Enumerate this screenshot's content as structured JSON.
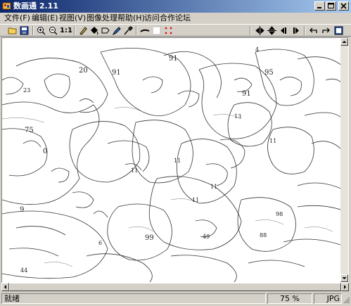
{
  "window": {
    "title": "数画通 2.11"
  },
  "menu": {
    "items": [
      {
        "label": "文件(F)"
      },
      {
        "label": "编辑(E)"
      },
      {
        "label": "视图(V)"
      },
      {
        "label": "图像处理"
      },
      {
        "label": "帮助(H)"
      },
      {
        "label": "访问合作论坛"
      }
    ]
  },
  "toolbar": {
    "icons": [
      "open-folder-icon",
      "save-disk-icon",
      "zoom-in-icon",
      "zoom-out-icon",
      "actual-size-icon",
      "pencil-icon",
      "flood-fill-icon",
      "lasso-icon",
      "pen-edit-icon",
      "eyedropper-icon",
      "brush-stroke-icon",
      "grid-toggle-icon",
      "dots-toggle-icon",
      "flip-horizontal-icon",
      "flip-vertical-icon",
      "mirror-left-icon",
      "mirror-right-icon",
      "undo-icon",
      "redo-icon",
      "fit-window-icon"
    ],
    "actual_size_label": "1:1"
  },
  "canvas": {
    "region_numbers": [
      "20",
      "91",
      "91",
      "95",
      "23",
      "91",
      "13",
      "75",
      "11",
      "0",
      "11",
      "11",
      "11",
      "9",
      "11",
      "98",
      "99",
      "88",
      "49",
      "6",
      "44",
      "4"
    ]
  },
  "status": {
    "left": "就绪",
    "zoom": "75 %",
    "format": "JPG"
  },
  "colors": {
    "titlebar_start": "#0a246a",
    "titlebar_end": "#a6caf0",
    "face": "#d4d0c8"
  }
}
